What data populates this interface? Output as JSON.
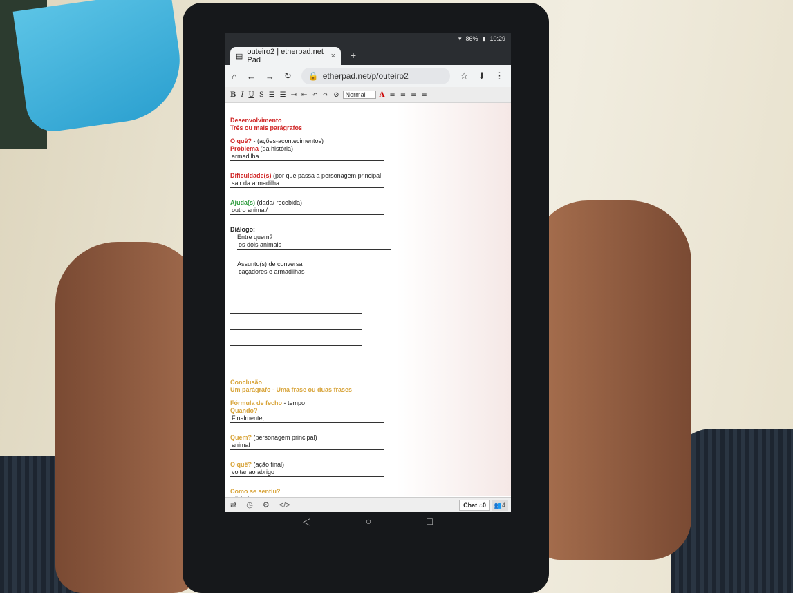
{
  "status": {
    "battery": "86%",
    "time": "10:29"
  },
  "browser": {
    "tab_title": "outeiro2 | etherpad.net Pad",
    "tab_close": "×",
    "new_tab": "+",
    "url": "etherpad.net/p/outeiro2"
  },
  "toolbar": {
    "style_select": "Normal"
  },
  "doc": {
    "desenvolvimento": "Desenvolvimento",
    "tres_paragrafos": "Três ou mais parágrafos",
    "o_que_label": "O quê?",
    "o_que_rest": " - (ações-acontecimentos)",
    "problema_label": "Problema",
    "problema_rest": " (da história)",
    "problema_answer": "armadilha",
    "dificuldades_label": "Dificuldade(s)",
    "dificuldades_rest": " (por que passa a personagem principal",
    "dificuldades_answer": "sair da armadilha",
    "ajuda_label": "Ajuda(s)",
    "ajuda_rest": " (dada/ recebida)",
    "ajuda_answer": "outro animal/",
    "dialogo": "Diálogo:",
    "entre_quem": "Entre quem?",
    "entre_quem_answer": "os dois animais",
    "assuntos": "Assunto(s) de conversa",
    "assuntos_answer": "caçadores e armadilhas",
    "conclusao": "Conclusão",
    "um_paragrafo": "Um parágrafo - Uma frase ou duas frases",
    "formula_label": "Fórmula de fecho",
    "formula_rest": " - tempo",
    "quando": "Quando?",
    "quando_answer": "Finalmente,",
    "quem_label": "Quem?",
    "quem_rest": " (personagem principal)",
    "quem_answer": "animal",
    "o_que2_label": "O quê?",
    "o_que2_rest": " (ação final)",
    "o_que2_answer": "voltar ao abrigo",
    "como_label": "Como se sentiu?",
    "como_answer": "aliviado"
  },
  "footer": {
    "chat_label": "Chat",
    "chat_count": "0",
    "users_count": "4"
  },
  "colors": {
    "red": "#d02626",
    "green": "#2a9a3a",
    "amber": "#d8a43a"
  }
}
